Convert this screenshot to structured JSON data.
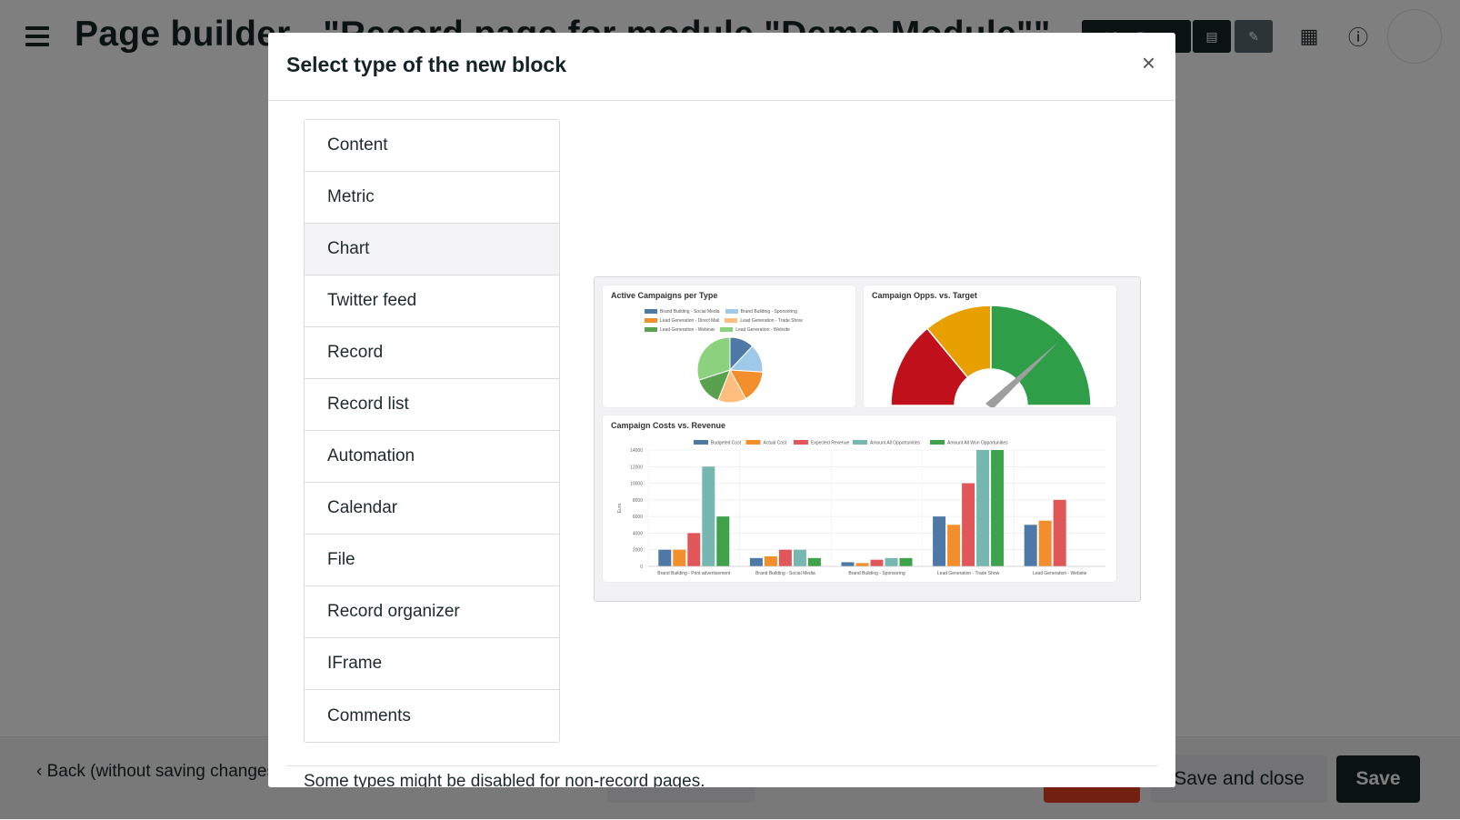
{
  "header": {
    "title": "Page builder - \"Record page for module \"Demo Module\"\"",
    "view_page_label": "View Page"
  },
  "footer": {
    "back_label": "Back (without saving changes)",
    "save_close_label": "Save and close",
    "save_label": "Save"
  },
  "modal": {
    "title": "Select type of the new block",
    "close_glyph": "×",
    "block_types": [
      "Content",
      "Metric",
      "Chart",
      "Twitter feed",
      "Record",
      "Record list",
      "Automation",
      "Calendar",
      "File",
      "Record organizer",
      "IFrame",
      "Comments"
    ],
    "selected": "Chart",
    "footnote": "Some types might be disabled for non-record pages."
  },
  "preview": {
    "pie": {
      "title": "Active Campaigns per Type",
      "legend": [
        {
          "label": "Brand Building - Social Media",
          "color": "#4e79a7"
        },
        {
          "label": "Brand Building - Sponsoring",
          "color": "#9ec9e8"
        },
        {
          "label": "Lead Generation - Direct Mail",
          "color": "#f28e2b"
        },
        {
          "label": "Lead Generation - Trade Show",
          "color": "#ffbe7d"
        },
        {
          "label": "Lead Generation - Webinar",
          "color": "#59a14f"
        },
        {
          "label": "Lead Generation - Website",
          "color": "#8cd17d"
        }
      ]
    },
    "gauge": {
      "title": "Campaign Opps. vs. Target",
      "colors": [
        "#c0101c",
        "#e8a000",
        "#2e9e48"
      ]
    },
    "bar": {
      "title": "Campaign Costs vs. Revenue",
      "ylabel": "Euro"
    }
  },
  "chart_data": {
    "type": "bar",
    "title": "Campaign Costs vs. Revenue",
    "ylabel": "Euro",
    "ylim": [
      0,
      14000
    ],
    "yticks": [
      0,
      2000,
      4000,
      6000,
      8000,
      10000,
      12000,
      14000
    ],
    "categories": [
      "Brand Building - Print advertisement",
      "Brand Building - Social Media",
      "Brand Building - Sponsoring",
      "Lead Generation - Trade Show",
      "Lead Generation - Website"
    ],
    "series": [
      {
        "name": "Budgeted Cost",
        "color": "#4e79a7",
        "values": [
          2000,
          1000,
          500,
          6000,
          5000
        ]
      },
      {
        "name": "Actual Cost",
        "color": "#f28e2b",
        "values": [
          2000,
          1200,
          400,
          5000,
          5500
        ]
      },
      {
        "name": "Expected Revenue",
        "color": "#e15759",
        "values": [
          4000,
          2000,
          800,
          10000,
          8000
        ]
      },
      {
        "name": "Amount All Opportunities",
        "color": "#76b7b2",
        "values": [
          12000,
          2000,
          1000,
          14000,
          0
        ]
      },
      {
        "name": "Amount All Won Opportunities",
        "color": "#3ea24a",
        "values": [
          6000,
          1000,
          1000,
          14000,
          0
        ]
      }
    ]
  }
}
